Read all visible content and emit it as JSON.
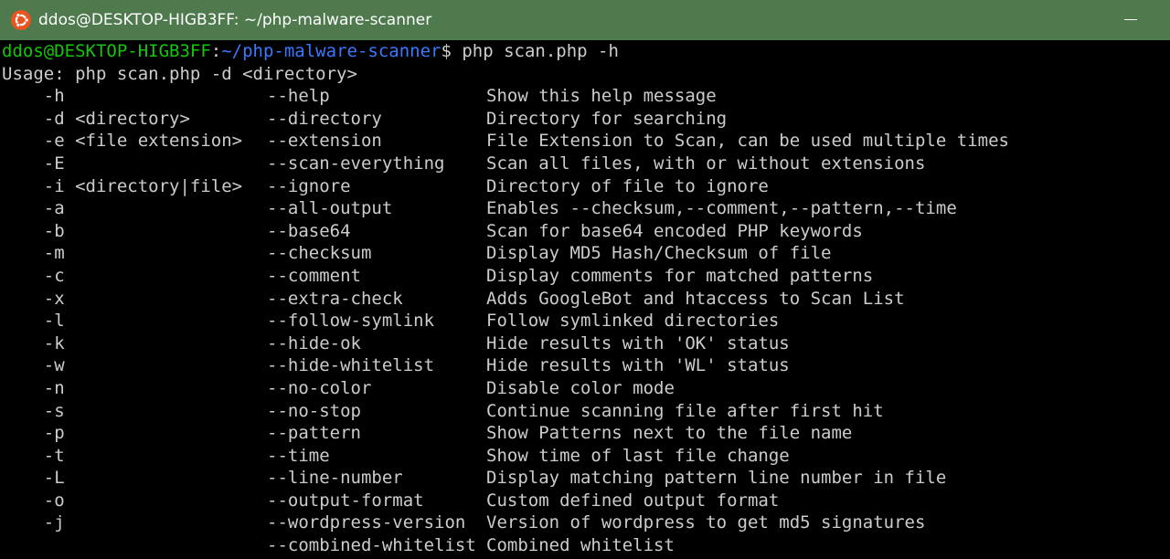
{
  "window": {
    "title": "ddos@DESKTOP-HIGB3FF: ~/php-malware-scanner",
    "icon": "ubuntu-icon",
    "titlebar_color": "#4e7a4e"
  },
  "terminal": {
    "prompt": {
      "user_host": "ddos@DESKTOP-HIGB3FF",
      "separator": ":",
      "path": "~/php-malware-scanner",
      "symbol": "$",
      "command": " php scan.php -h"
    },
    "usage_line": "Usage: php scan.php -d <directory>",
    "options": [
      {
        "short": "    -h",
        "long": "--help",
        "desc": "Show this help message"
      },
      {
        "short": "    -d <directory>",
        "long": "--directory",
        "desc": "Directory for searching"
      },
      {
        "short": "    -e <file extension>",
        "long": "--extension",
        "desc": "File Extension to Scan, can be used multiple times"
      },
      {
        "short": "    -E",
        "long": "--scan-everything",
        "desc": "Scan all files, with or without extensions"
      },
      {
        "short": "    -i <directory|file>",
        "long": "--ignore",
        "desc": "Directory of file to ignore"
      },
      {
        "short": "    -a",
        "long": "--all-output",
        "desc": "Enables --checksum,--comment,--pattern,--time"
      },
      {
        "short": "    -b",
        "long": "--base64",
        "desc": "Scan for base64 encoded PHP keywords"
      },
      {
        "short": "    -m",
        "long": "--checksum",
        "desc": "Display MD5 Hash/Checksum of file"
      },
      {
        "short": "    -c",
        "long": "--comment",
        "desc": "Display comments for matched patterns"
      },
      {
        "short": "    -x",
        "long": "--extra-check",
        "desc": "Adds GoogleBot and htaccess to Scan List"
      },
      {
        "short": "    -l",
        "long": "--follow-symlink",
        "desc": "Follow symlinked directories"
      },
      {
        "short": "    -k",
        "long": "--hide-ok",
        "desc": "Hide results with 'OK' status"
      },
      {
        "short": "    -w",
        "long": "--hide-whitelist",
        "desc": "Hide results with 'WL' status"
      },
      {
        "short": "    -n",
        "long": "--no-color",
        "desc": "Disable color mode"
      },
      {
        "short": "    -s",
        "long": "--no-stop",
        "desc": "Continue scanning file after first hit"
      },
      {
        "short": "    -p",
        "long": "--pattern",
        "desc": "Show Patterns next to the file name"
      },
      {
        "short": "    -t",
        "long": "--time",
        "desc": "Show time of last file change"
      },
      {
        "short": "    -L",
        "long": "--line-number",
        "desc": "Display matching pattern line number in file"
      },
      {
        "short": "    -o",
        "long": "--output-format",
        "desc": "Custom defined output format"
      },
      {
        "short": "    -j",
        "long": "--wordpress-version",
        "desc": "Version of wordpress to get md5 signatures"
      },
      {
        "short": "",
        "long": "--combined-whitelist",
        "desc": "Combined whitelist"
      }
    ],
    "colors": {
      "background": "#000000",
      "text": "#cccccc",
      "user_host": "#16c60c",
      "path": "#3b78ff"
    }
  }
}
